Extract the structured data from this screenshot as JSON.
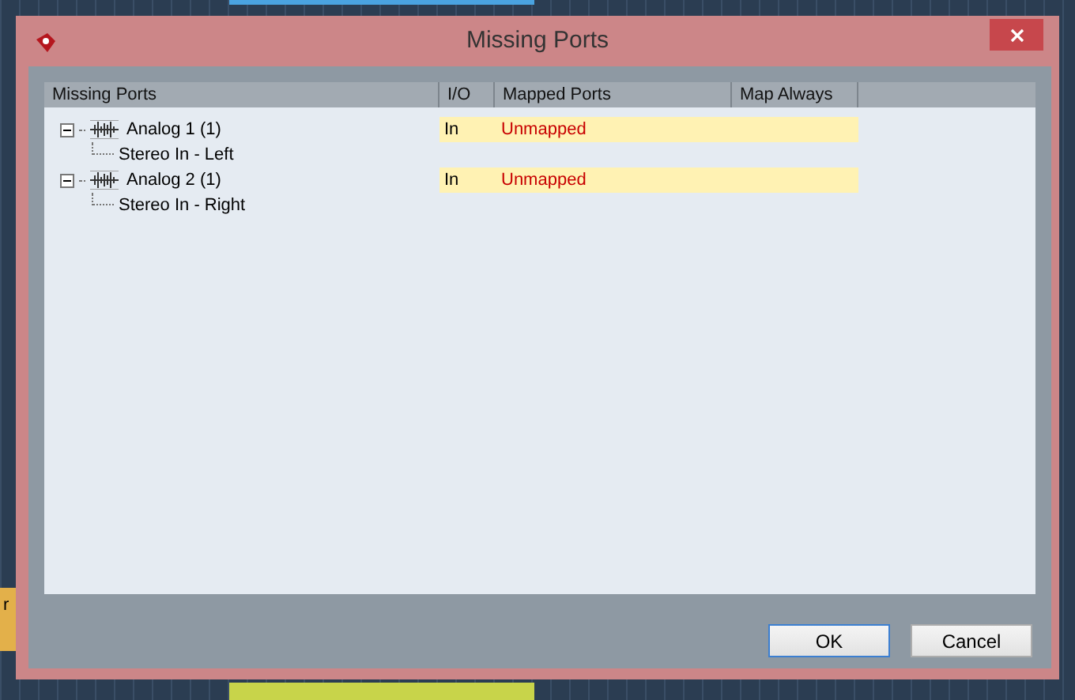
{
  "background_clip": {
    "label": "r"
  },
  "window": {
    "title": "Missing Ports"
  },
  "columns": [
    "Missing Ports",
    "I/O",
    "Mapped Ports",
    "Map Always"
  ],
  "ports": [
    {
      "name": "Analog 1 (1)",
      "io": "In",
      "mapped": "Unmapped",
      "expanded": true,
      "children": [
        {
          "name": "Stereo In - Left"
        }
      ]
    },
    {
      "name": "Analog 2 (1)",
      "io": "In",
      "mapped": "Unmapped",
      "expanded": true,
      "children": [
        {
          "name": "Stereo In - Right"
        }
      ]
    }
  ],
  "buttons": [
    {
      "label": "OK",
      "selected": true
    },
    {
      "label": "Cancel",
      "selected": false
    }
  ]
}
